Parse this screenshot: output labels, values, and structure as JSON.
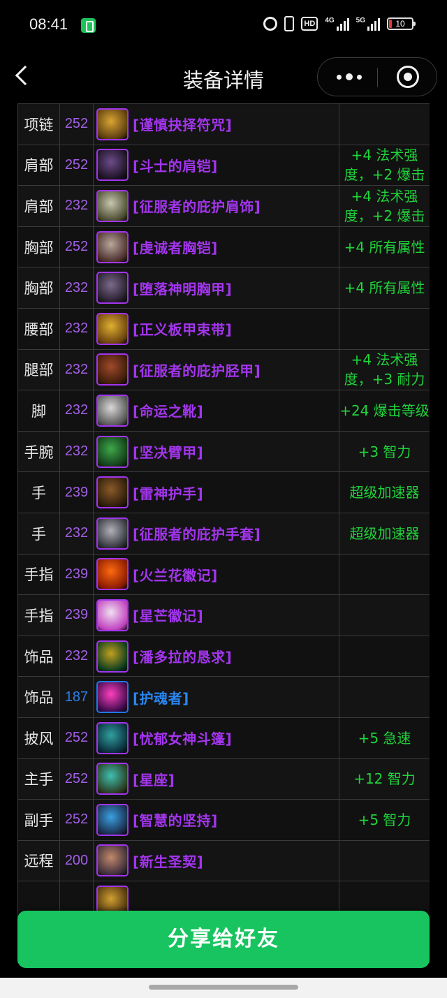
{
  "status_bar": {
    "time": "08:41",
    "hd_label": "HD",
    "net1_label": "4G",
    "net2_label": "5G",
    "battery": "10"
  },
  "nav": {
    "title": "装备详情"
  },
  "gear": [
    {
      "slot": "项链",
      "ilvl": "252",
      "name": "[谨慎抉择符咒]",
      "stat": "",
      "icon": "necklace-icon",
      "colors": [
        "#d9a531",
        "#5a3b10"
      ]
    },
    {
      "slot": "肩部",
      "ilvl": "252",
      "name": "[斗士的肩铠]",
      "stat": "+4 法术强度，+2 爆击",
      "icon": "shoulder-icon",
      "colors": [
        "#6b4c8a",
        "#1a1020"
      ]
    },
    {
      "slot": "肩部",
      "ilvl": "232",
      "name": "[征服者的庇护肩饰]",
      "stat": "+4 法术强度，+2 爆击",
      "icon": "shoulder-icon",
      "colors": [
        "#c7c7b0",
        "#4a4a30"
      ]
    },
    {
      "slot": "胸部",
      "ilvl": "252",
      "name": "[虔诚者胸铠]",
      "stat": "+4 所有属性",
      "icon": "chest-icon",
      "colors": [
        "#b8a89a",
        "#4a2c2c"
      ]
    },
    {
      "slot": "胸部",
      "ilvl": "232",
      "name": "[堕落神明胸甲]",
      "stat": "+4 所有属性",
      "icon": "chest-icon",
      "colors": [
        "#7b6a8a",
        "#221a28"
      ]
    },
    {
      "slot": "腰部",
      "ilvl": "232",
      "name": "[正义板甲束带]",
      "stat": "",
      "icon": "belt-icon",
      "colors": [
        "#e0b030",
        "#6a4010"
      ]
    },
    {
      "slot": "腿部",
      "ilvl": "232",
      "name": "[征服者的庇护胫甲]",
      "stat": "+4 法术强度，+3 耐力",
      "icon": "legs-icon",
      "colors": [
        "#a04a2a",
        "#3a1a0a"
      ]
    },
    {
      "slot": "脚",
      "ilvl": "232",
      "name": "[命运之靴]",
      "stat": "+24 爆击等级",
      "icon": "boots-icon",
      "colors": [
        "#d8d8d8",
        "#555"
      ]
    },
    {
      "slot": "手腕",
      "ilvl": "232",
      "name": "[坚决臂甲]",
      "stat": "+3 智力",
      "icon": "bracer-icon",
      "colors": [
        "#3ea84a",
        "#123a18"
      ]
    },
    {
      "slot": "手",
      "ilvl": "239",
      "name": "[雷神护手]",
      "stat": "超级加速器",
      "icon": "gloves-icon",
      "colors": [
        "#8a5a2a",
        "#2a1a0a"
      ]
    },
    {
      "slot": "手",
      "ilvl": "232",
      "name": "[征服者的庇护手套]",
      "stat": "超级加速器",
      "icon": "gloves-icon",
      "colors": [
        "#b0b0b8",
        "#303038"
      ]
    },
    {
      "slot": "手指",
      "ilvl": "239",
      "name": "[火兰花徽记]",
      "stat": "",
      "icon": "ring-icon",
      "colors": [
        "#ff6a10",
        "#8a1a00"
      ]
    },
    {
      "slot": "手指",
      "ilvl": "239",
      "name": "[星芒徽记]",
      "stat": "",
      "icon": "ring-icon",
      "colors": [
        "#f0e0f0",
        "#c040c0"
      ]
    },
    {
      "slot": "饰品",
      "ilvl": "232",
      "name": "[潘多拉的恳求]",
      "stat": "",
      "icon": "trinket-icon",
      "colors": [
        "#c0a020",
        "#0a3a20"
      ]
    },
    {
      "slot": "饰品",
      "ilvl": "187",
      "name": "[护魂者]",
      "stat": "",
      "icon": "trinket-icon",
      "colors": [
        "#ff40c0",
        "#3a0a4a"
      ],
      "rare": true
    },
    {
      "slot": "披风",
      "ilvl": "252",
      "name": "[忧郁女神斗篷]",
      "stat": "+5 急速",
      "icon": "cloak-icon",
      "colors": [
        "#30a0a0",
        "#0a2a3a"
      ]
    },
    {
      "slot": "主手",
      "ilvl": "252",
      "name": "[星座]",
      "stat": "+12 智力",
      "icon": "mainhand-icon",
      "colors": [
        "#40c0b0",
        "#2a3a20"
      ]
    },
    {
      "slot": "副手",
      "ilvl": "252",
      "name": "[智慧的坚持]",
      "stat": "+5 智力",
      "icon": "offhand-icon",
      "colors": [
        "#3aa0e0",
        "#1a2a4a"
      ]
    },
    {
      "slot": "远程",
      "ilvl": "200",
      "name": "[新生圣契]",
      "stat": "",
      "icon": "relic-icon",
      "colors": [
        "#c08a6a",
        "#3a2a3a"
      ]
    },
    {
      "slot": "",
      "ilvl": "",
      "name": "",
      "stat": "",
      "icon": "item-icon",
      "colors": [
        "#d0a030",
        "#4a3010"
      ]
    },
    {
      "slot": "",
      "ilvl": "",
      "name": "",
      "stat": "",
      "icon": "item-icon",
      "colors": [
        "#e0e0c0",
        "#2a6a2a"
      ]
    }
  ],
  "share_button": "分享给好友"
}
